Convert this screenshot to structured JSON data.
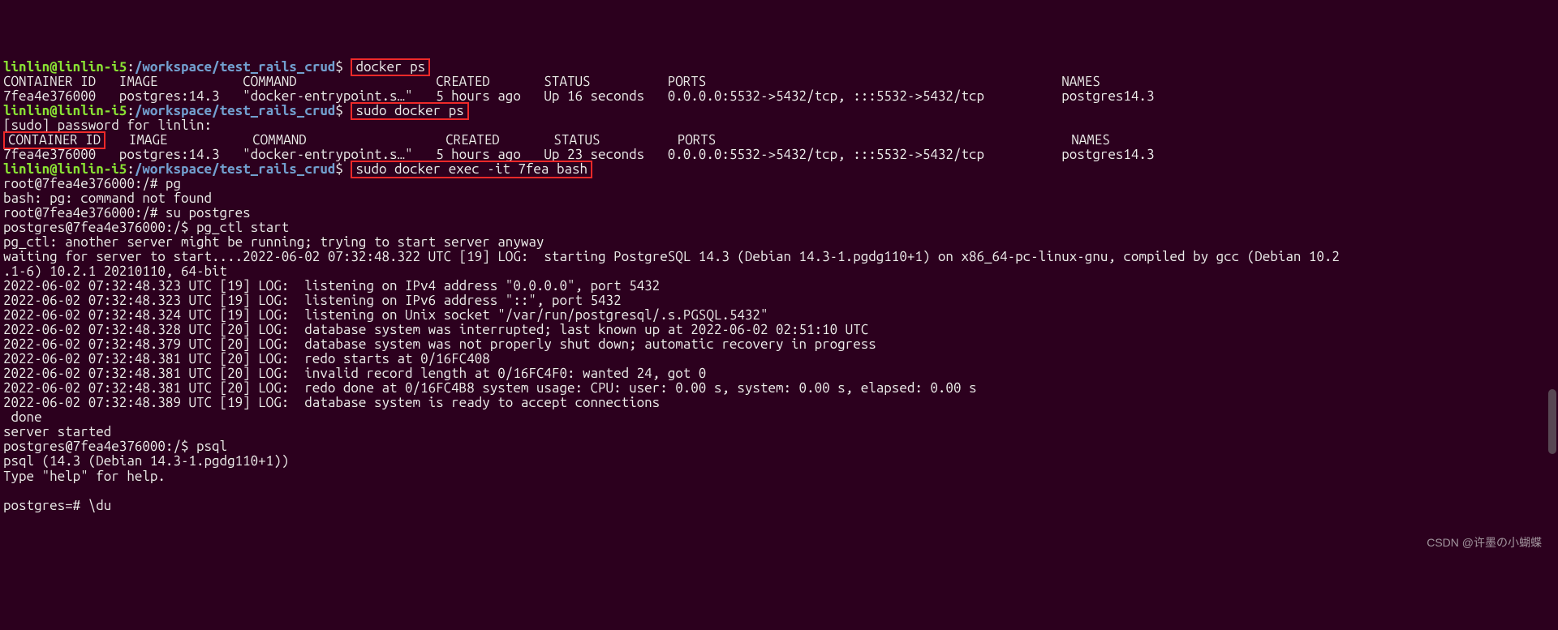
{
  "prompt": {
    "user_host": "linlin@linlin-i5",
    "colon": ":",
    "path": "/workspace/test_rails_crud",
    "dollar": "$"
  },
  "cmd1": "docker ps",
  "header1": "CONTAINER ID   IMAGE           COMMAND                  CREATED       STATUS          PORTS                                              NAMES",
  "row1": "7fea4e376000   postgres:14.3   \"docker-entrypoint.s…\"   5 hours ago   Up 16 seconds   0.0.0.0:5532->5432/tcp, :::5532->5432/tcp          postgres14.3",
  "cmd2": "sudo docker ps",
  "sudo_line": "[sudo] password for linlin:",
  "header2_a": "CONTAINER ID",
  "header2_b": "   IMAGE           COMMAND                  CREATED       STATUS          PORTS                                              NAMES",
  "row2": "7fea4e376000   postgres:14.3   \"docker-entrypoint.s…\"   5 hours ago   Up 23 seconds   0.0.0.0:5532->5432/tcp, :::5532->5432/tcp          postgres14.3",
  "cmd3": "sudo docker exec -it 7fea bash",
  "logs": [
    "root@7fea4e376000:/# pg",
    "bash: pg: command not found",
    "root@7fea4e376000:/# su postgres",
    "postgres@7fea4e376000:/$ pg_ctl start",
    "pg_ctl: another server might be running; trying to start server anyway",
    "waiting for server to start....2022-06-02 07:32:48.322 UTC [19] LOG:  starting PostgreSQL 14.3 (Debian 14.3-1.pgdg110+1) on x86_64-pc-linux-gnu, compiled by gcc (Debian 10.2",
    ".1-6) 10.2.1 20210110, 64-bit",
    "2022-06-02 07:32:48.323 UTC [19] LOG:  listening on IPv4 address \"0.0.0.0\", port 5432",
    "2022-06-02 07:32:48.323 UTC [19] LOG:  listening on IPv6 address \"::\", port 5432",
    "2022-06-02 07:32:48.324 UTC [19] LOG:  listening on Unix socket \"/var/run/postgresql/.s.PGSQL.5432\"",
    "2022-06-02 07:32:48.328 UTC [20] LOG:  database system was interrupted; last known up at 2022-06-02 02:51:10 UTC",
    "2022-06-02 07:32:48.379 UTC [20] LOG:  database system was not properly shut down; automatic recovery in progress",
    "2022-06-02 07:32:48.381 UTC [20] LOG:  redo starts at 0/16FC408",
    "2022-06-02 07:32:48.381 UTC [20] LOG:  invalid record length at 0/16FC4F0: wanted 24, got 0",
    "2022-06-02 07:32:48.381 UTC [20] LOG:  redo done at 0/16FC4B8 system usage: CPU: user: 0.00 s, system: 0.00 s, elapsed: 0.00 s",
    "2022-06-02 07:32:48.389 UTC [19] LOG:  database system is ready to accept connections",
    " done",
    "server started",
    "postgres@7fea4e376000:/$ psql",
    "psql (14.3 (Debian 14.3-1.pgdg110+1))",
    "Type \"help\" for help.",
    "",
    "postgres=# \\du"
  ],
  "watermark": "CSDN @许墨の小蝴蝶"
}
